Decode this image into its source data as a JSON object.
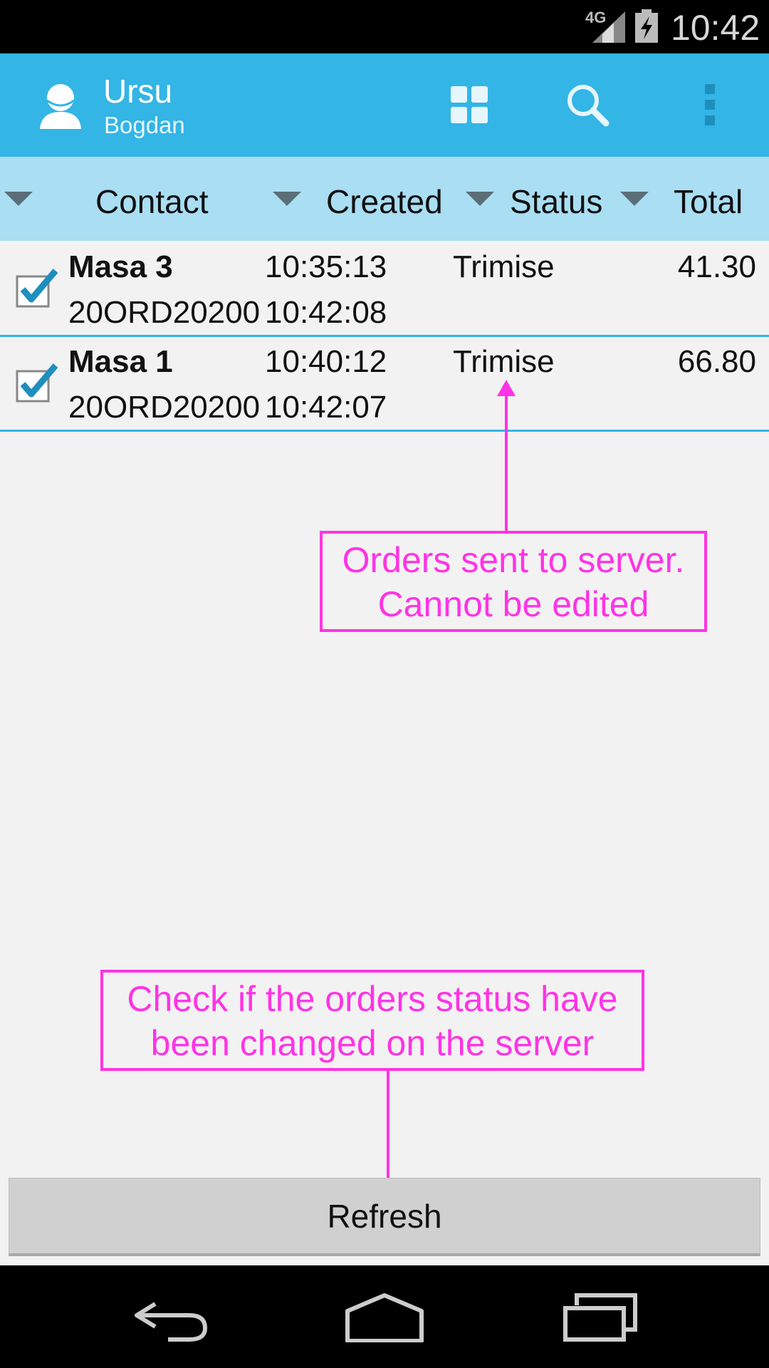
{
  "status_bar": {
    "network": "4G",
    "time": "10:42"
  },
  "action_bar": {
    "user_first": "Ursu",
    "user_last": "Bogdan",
    "icons": [
      "user-icon",
      "grid-icon",
      "search-icon",
      "overflow-menu-icon"
    ]
  },
  "columns": {
    "contact": "Contact",
    "created": "Created",
    "status": "Status",
    "total": "Total"
  },
  "orders": [
    {
      "name": "Masa 3",
      "code": "20ORD20200",
      "created": "10:35:13",
      "updated": "10:42:08",
      "status": "Trimise",
      "total": "41.30",
      "checked": true
    },
    {
      "name": "Masa 1",
      "code": "20ORD20200",
      "created": "10:40:12",
      "updated": "10:42:07",
      "status": "Trimise",
      "total": "66.80",
      "checked": true
    }
  ],
  "annotations": {
    "orders_sent_line1": "Orders sent to server.",
    "orders_sent_line2": "Cannot be edited",
    "check_status_line1": "Check if the orders status have",
    "check_status_line2": "been changed on the server"
  },
  "refresh_label": "Refresh",
  "colors": {
    "action_bar": "#33b5e5",
    "column_header": "#a9def3",
    "annotation": "#ff33e5",
    "button": "#d0d0d0"
  }
}
